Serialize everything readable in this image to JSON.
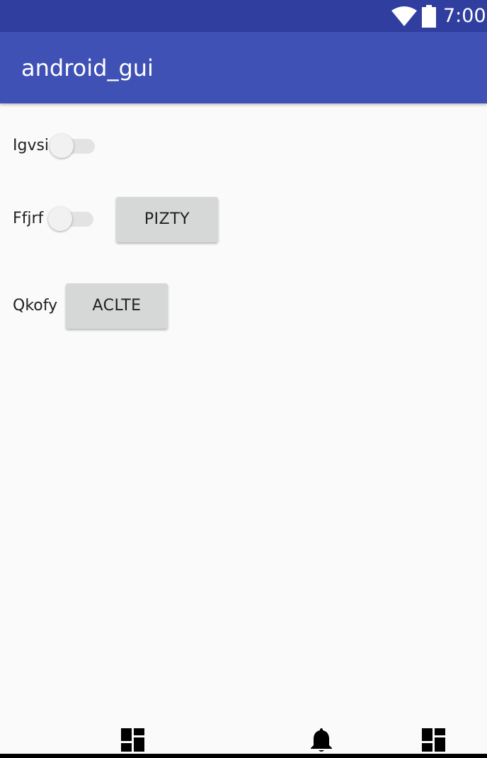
{
  "status_bar": {
    "time": "7:00",
    "wifi_icon": "wifi-icon",
    "battery_icon": "battery-icon",
    "background": "#303f9f"
  },
  "app_bar": {
    "title": "android_gui",
    "background": "#3f51b5"
  },
  "content": {
    "rows": [
      {
        "label": "Igvsi",
        "switch_on": false
      },
      {
        "label": "Ffjrf",
        "switch_on": false,
        "button": "PIZTY"
      },
      {
        "label": "Qkofy",
        "button": "ACLTE"
      }
    ]
  },
  "bottom_nav": {
    "items": [
      "dashboard-icon",
      "notification-bell-icon",
      "dashboard-icon"
    ]
  }
}
